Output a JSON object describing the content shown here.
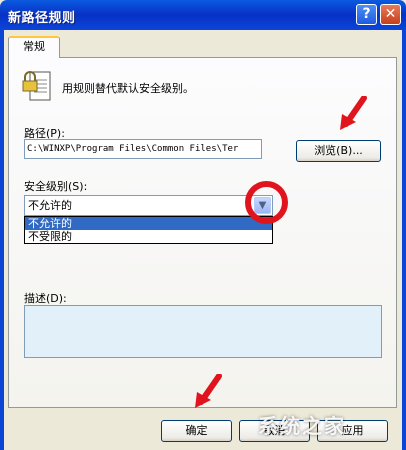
{
  "window": {
    "title": "新路径规则",
    "help_glyph": "?",
    "close_glyph": "✕"
  },
  "tabs": [
    {
      "label": "常规"
    }
  ],
  "description": "用规则替代默认安全级别。",
  "path": {
    "label": "路径(P):",
    "value": "C:\\WINXP\\Program Files\\Common Files\\Ter",
    "browse_label": "浏览(B)..."
  },
  "security_level": {
    "label": "安全级别(S):",
    "selected": "不允许的",
    "options": [
      "不允许的",
      "不受限的"
    ]
  },
  "desc_field": {
    "label": "描述(D):",
    "value": ""
  },
  "footer": {
    "ok_label": "确定",
    "cancel_label": "取消",
    "apply_label": "应用"
  },
  "watermark": "系统之家",
  "colors": {
    "accent_red": "#e0141c",
    "titlebar_blue": "#0831c5",
    "selection": "#316ac5"
  }
}
